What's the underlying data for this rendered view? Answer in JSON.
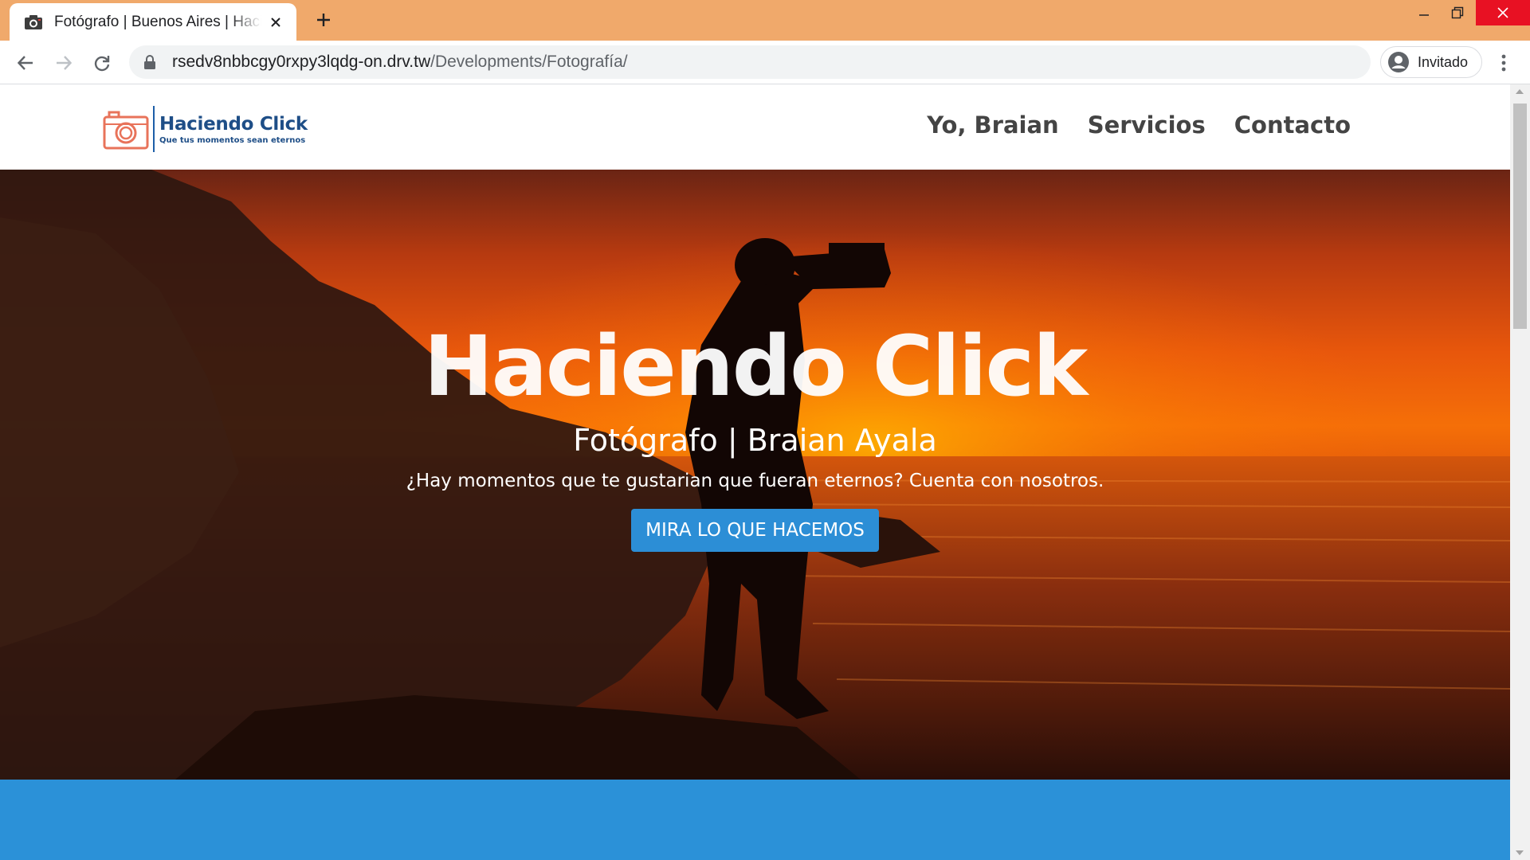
{
  "browser": {
    "tab_title": "Fotógrafo | Buenos Aires | Haciendo Click",
    "url_host": "rsedv8nbbcgy0rxpy3lqdg-on.drv.tw",
    "url_path": "/Developments/Fotografía/",
    "profile_label": "Invitado",
    "frame_color": "#f0a96b",
    "icons": [
      "camera-favicon-icon",
      "close-icon",
      "plus-icon",
      "minimize-icon",
      "restore-icon",
      "close-window-icon",
      "back-arrow-icon",
      "forward-arrow-icon",
      "reload-icon",
      "lock-icon",
      "avatar-icon",
      "kebab-menu-icon"
    ]
  },
  "site": {
    "logo": {
      "title": "Haciendo Click",
      "tagline": "Que tus momentos sean eternos",
      "icon": "camera-icon",
      "color": "#1e4e87",
      "icon_color": "#e8735a"
    },
    "nav": [
      {
        "label": "Yo, Braian"
      },
      {
        "label": "Servicios"
      },
      {
        "label": "Contacto"
      }
    ],
    "hero": {
      "title": "Haciendo Click",
      "subtitle": "Fotógrafo | Braian Ayala",
      "text": "¿Hay momentos que te gustarian que fueran eternos? Cuenta con nosotros.",
      "button_label": "MIRA LO QUE HACEMOS",
      "button_color": "#2c8ed6"
    },
    "band_color": "#2b91d8"
  }
}
